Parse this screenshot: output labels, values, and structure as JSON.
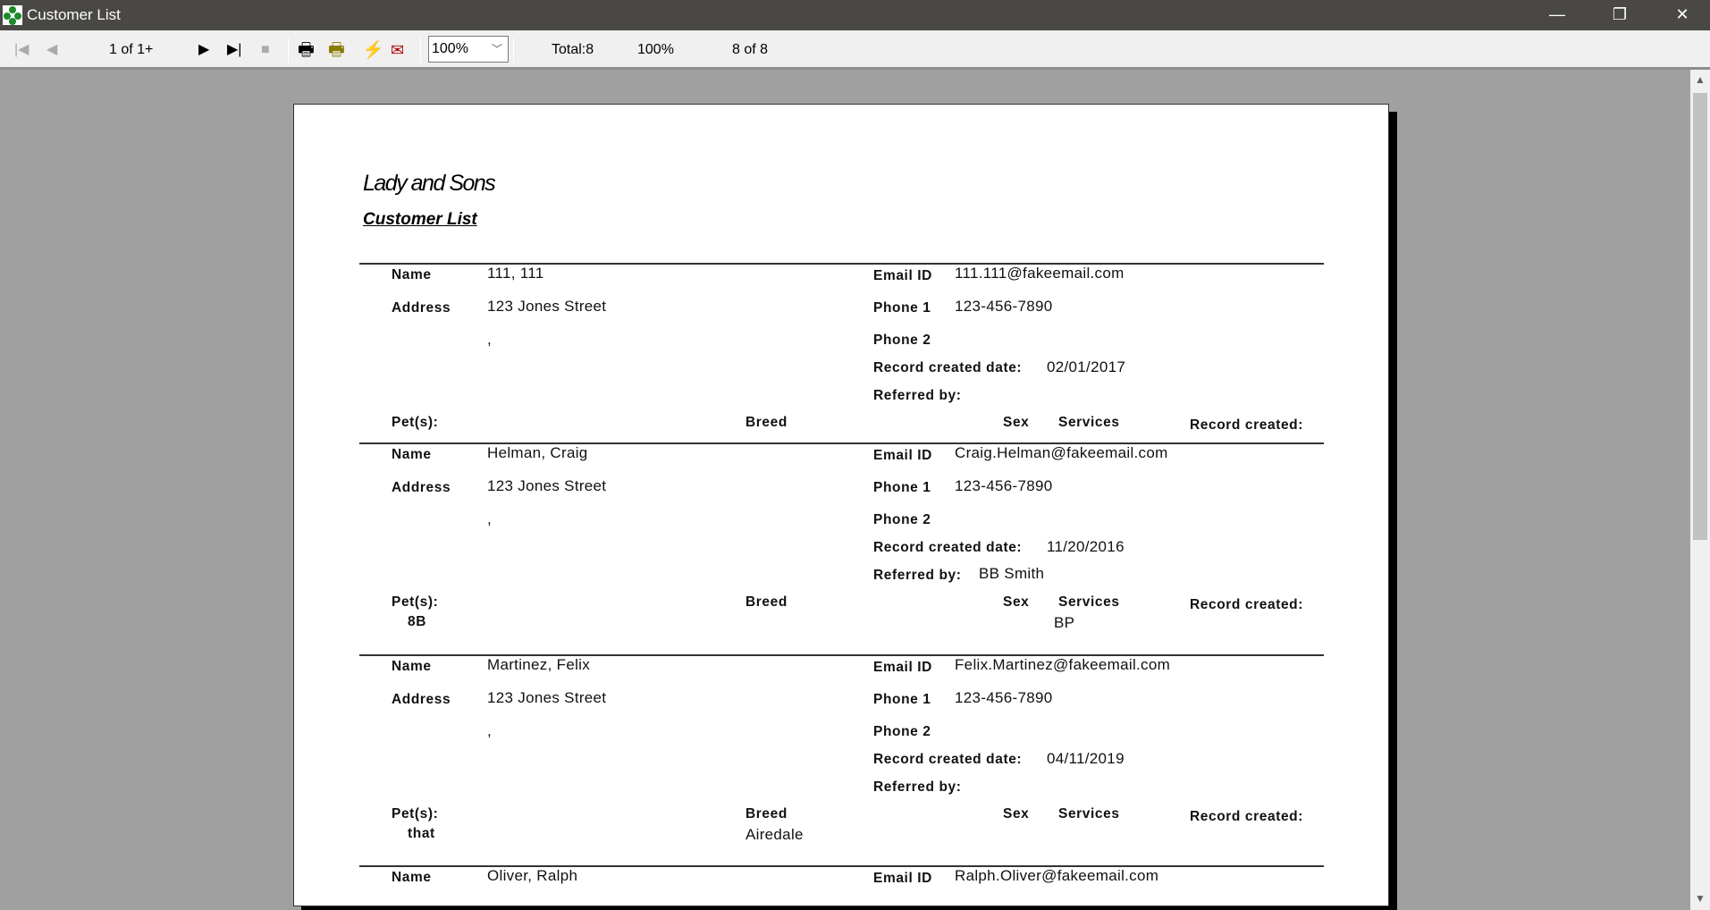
{
  "window": {
    "title": "Customer List",
    "minimize": "—",
    "restore": "❐",
    "close": "✕"
  },
  "toolbar": {
    "page_indicator": "1 of 1+",
    "zoom_value": "100%",
    "total": "Total:8",
    "percent": "100%",
    "records": "8 of 8"
  },
  "report": {
    "company": "Lady and Sons",
    "title": "Customer List",
    "labels": {
      "name": "Name",
      "address": "Address",
      "email": "Email ID",
      "phone1": "Phone 1",
      "phone2": "Phone 2",
      "record_created_date": "Record created date:",
      "referred_by": "Referred by:",
      "pets": "Pet(s):",
      "breed": "Breed",
      "sex": "Sex",
      "services": "Services",
      "record_created": "Record created:"
    },
    "records": [
      {
        "name": "111, 111",
        "address": "123 Jones Street",
        "address2": ",",
        "email": "111.111@fakeemail.com",
        "phone1": "123-456-7890",
        "phone2": "",
        "created": "02/01/2017",
        "referred": "",
        "pets": []
      },
      {
        "name": "Helman, Craig",
        "address": "123 Jones Street",
        "address2": ",",
        "email": "Craig.Helman@fakeemail.com",
        "phone1": "123-456-7890",
        "phone2": "",
        "created": "11/20/2016",
        "referred": "BB Smith",
        "pets": [
          {
            "pet": "8B",
            "breed": "",
            "sex": "",
            "services": "BP",
            "created": ""
          }
        ]
      },
      {
        "name": "Martinez, Felix",
        "address": "123 Jones Street",
        "address2": ",",
        "email": "Felix.Martinez@fakeemail.com",
        "phone1": "123-456-7890",
        "phone2": "",
        "created": "04/11/2019",
        "referred": "",
        "pets": [
          {
            "pet": "that",
            "breed": "Airedale",
            "sex": "",
            "services": "",
            "created": ""
          }
        ]
      },
      {
        "name": "Oliver, Ralph",
        "email": "Ralph.Oliver@fakeemail.com"
      }
    ]
  }
}
